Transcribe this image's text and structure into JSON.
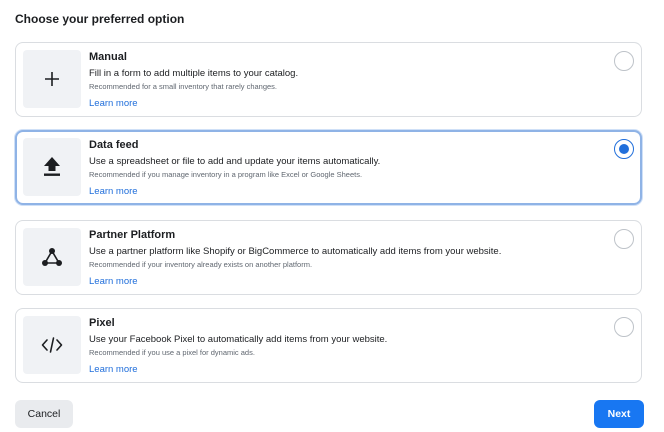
{
  "heading": "Choose your preferred option",
  "colors": {
    "accent": "#1877f2",
    "link": "#216fdb",
    "tile_bg": "#f0f2f5"
  },
  "options": [
    {
      "title": "Manual",
      "description": "Fill in a form to add multiple items to your catalog.",
      "recommendation": "Recommended for a small inventory that rarely changes.",
      "link": "Learn more",
      "icon": "plus-icon",
      "selected": false
    },
    {
      "title": "Data feed",
      "description": "Use a spreadsheet or file to add and update your items automatically.",
      "recommendation": "Recommended if you manage inventory in a program like Excel or Google Sheets.",
      "link": "Learn more",
      "icon": "upload-icon",
      "selected": true
    },
    {
      "title": "Partner Platform",
      "description": "Use a partner platform like Shopify or BigCommerce to automatically add items from your website.",
      "recommendation": "Recommended if your inventory already exists on another platform.",
      "link": "Learn more",
      "icon": "network-icon",
      "selected": false
    },
    {
      "title": "Pixel",
      "description": "Use your Facebook Pixel to automatically add items from your website.",
      "recommendation": "Recommended if you use a pixel for dynamic ads.",
      "link": "Learn more",
      "icon": "code-icon",
      "selected": false
    }
  ],
  "footer": {
    "cancel_label": "Cancel",
    "next_label": "Next"
  }
}
